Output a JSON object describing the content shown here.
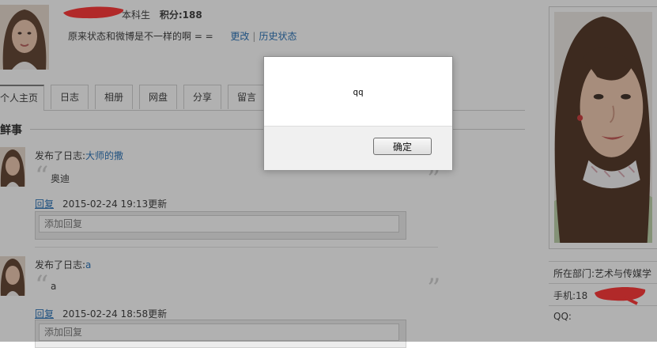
{
  "profile": {
    "level": "本科生",
    "score_label": "积分:",
    "score": "188",
    "status_text": "原来状态和微博是不一样的啊 = =",
    "change_link": "更改",
    "divider": "|",
    "history_link": "历史状态"
  },
  "tabs": [
    "个人主页",
    "日志",
    "相册",
    "网盘",
    "分享",
    "留言"
  ],
  "section_title": "鲜事",
  "feed": [
    {
      "action": "发布了日志:",
      "title_link": "大师的撒",
      "body": "奥迪",
      "reply_label": "回复",
      "time": "2015-02-24 19:13更新",
      "reply_placeholder": "添加回复"
    },
    {
      "action": "发布了日志:",
      "title_link": "a",
      "body": "a",
      "reply_label": "回复",
      "time": "2015-02-24 18:58更新",
      "reply_placeholder": "添加回复"
    }
  ],
  "quote_open": "“",
  "quote_close": "”",
  "sidebar_info": {
    "department": "所在部门:艺术与传媒学",
    "phone": "手机:18",
    "qq": "QQ:"
  },
  "dialog": {
    "message": "qq",
    "ok_label": "确定"
  },
  "colors": {
    "link": "#1f6bb3",
    "redaction": "#ff2b2b",
    "overlay": "rgba(40,40,40,0.36)"
  }
}
